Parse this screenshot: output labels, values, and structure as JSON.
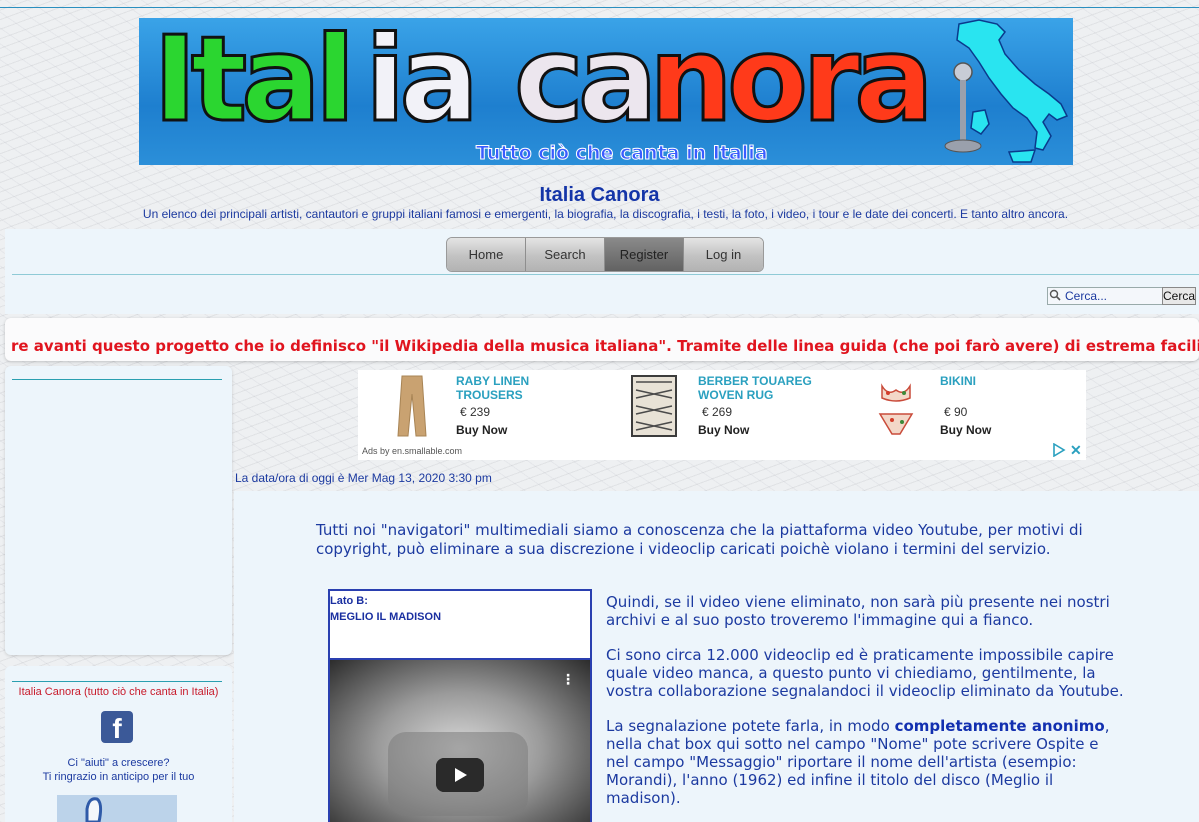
{
  "banner": {
    "word1": "Ital",
    "word2": "ia",
    "word3": "ca",
    "word4": "nora",
    "tagline": "Tutto ciò che canta in Italia"
  },
  "site": {
    "title": "Italia Canora",
    "description": "Un elenco dei principali artisti, cantautori e gruppi italiani famosi e emergenti, la biografia, la discografia, i testi, la foto, i video, i tour e le date dei concerti. E tanto altro ancora."
  },
  "nav": {
    "items": [
      {
        "label": "Home"
      },
      {
        "label": "Search"
      },
      {
        "label": "Register"
      },
      {
        "label": "Log in"
      }
    ]
  },
  "search": {
    "placeholder": "Cerca...",
    "button_label": "Cerca"
  },
  "marquee": {
    "text": "re avanti questo progetto che io definisco \"il Wikipedia della musica italiana\". Tramite delle linea guida (che poi farò avere) di estrema facilità"
  },
  "ad": {
    "items": [
      {
        "title": "RABY LINEN TROUSERS",
        "price": "€ 239",
        "cta": "Buy Now"
      },
      {
        "title": "BERBER TOUAREG WOVEN RUG",
        "price": "€ 269",
        "cta": "Buy Now"
      },
      {
        "title": "BIKINI",
        "price": "€ 90",
        "cta": "Buy Now"
      }
    ],
    "footer": "Ads by en.smallable.com",
    "close": "✕"
  },
  "datetime": "La data/ora di oggi è Mer Mag 13, 2020 3:30 pm",
  "sidebar": {
    "heading": "Italia Canora (tutto ciò che canta in Italia)",
    "fb_letter": "f",
    "help_line1": "Ci \"aiuti\" a crescere?",
    "help_line2": "Ti ringrazio in anticipo per il tuo"
  },
  "content": {
    "intro": "Tutti noi \"navigatori\" multimediali siamo a conoscenza che la piattaforma video Youtube, per motivi di copyright, può eliminare a sua discrezione i videoclip caricati poichè violano i termini del servizio.",
    "video_caption_line1": "Lato B:",
    "video_caption_line2": "MEGLIO IL MADISON",
    "para1": "Quindi, se il video viene eliminato, non sarà più presente nei nostri archivi e al suo posto troveremo l'immagine qui a fianco.",
    "para2": "Ci sono circa 12.000 videoclip ed è praticamente impossibile capire quale video manca, a questo punto vi chiediamo, gentilmente, la vostra collaborazione segnalandoci il videoclip eliminato da Youtube.",
    "para3_start": "La segnalazione potete farla, in modo ",
    "para3_bold": "completamente anonimo",
    "para3_end": ", nella chat box qui sotto nel campo \"Nome\" pote scrivere Ospite e nel campo \"Messaggio\" riportare il nome dell'artista (esempio: Morandi), l'anno (1962) ed infine il titolo del disco (Meglio il madison)."
  },
  "colors": {
    "accent_blue": "#1c3aa0",
    "marquee_red": "#e0141e",
    "nav_active": "#6e6e6e"
  }
}
